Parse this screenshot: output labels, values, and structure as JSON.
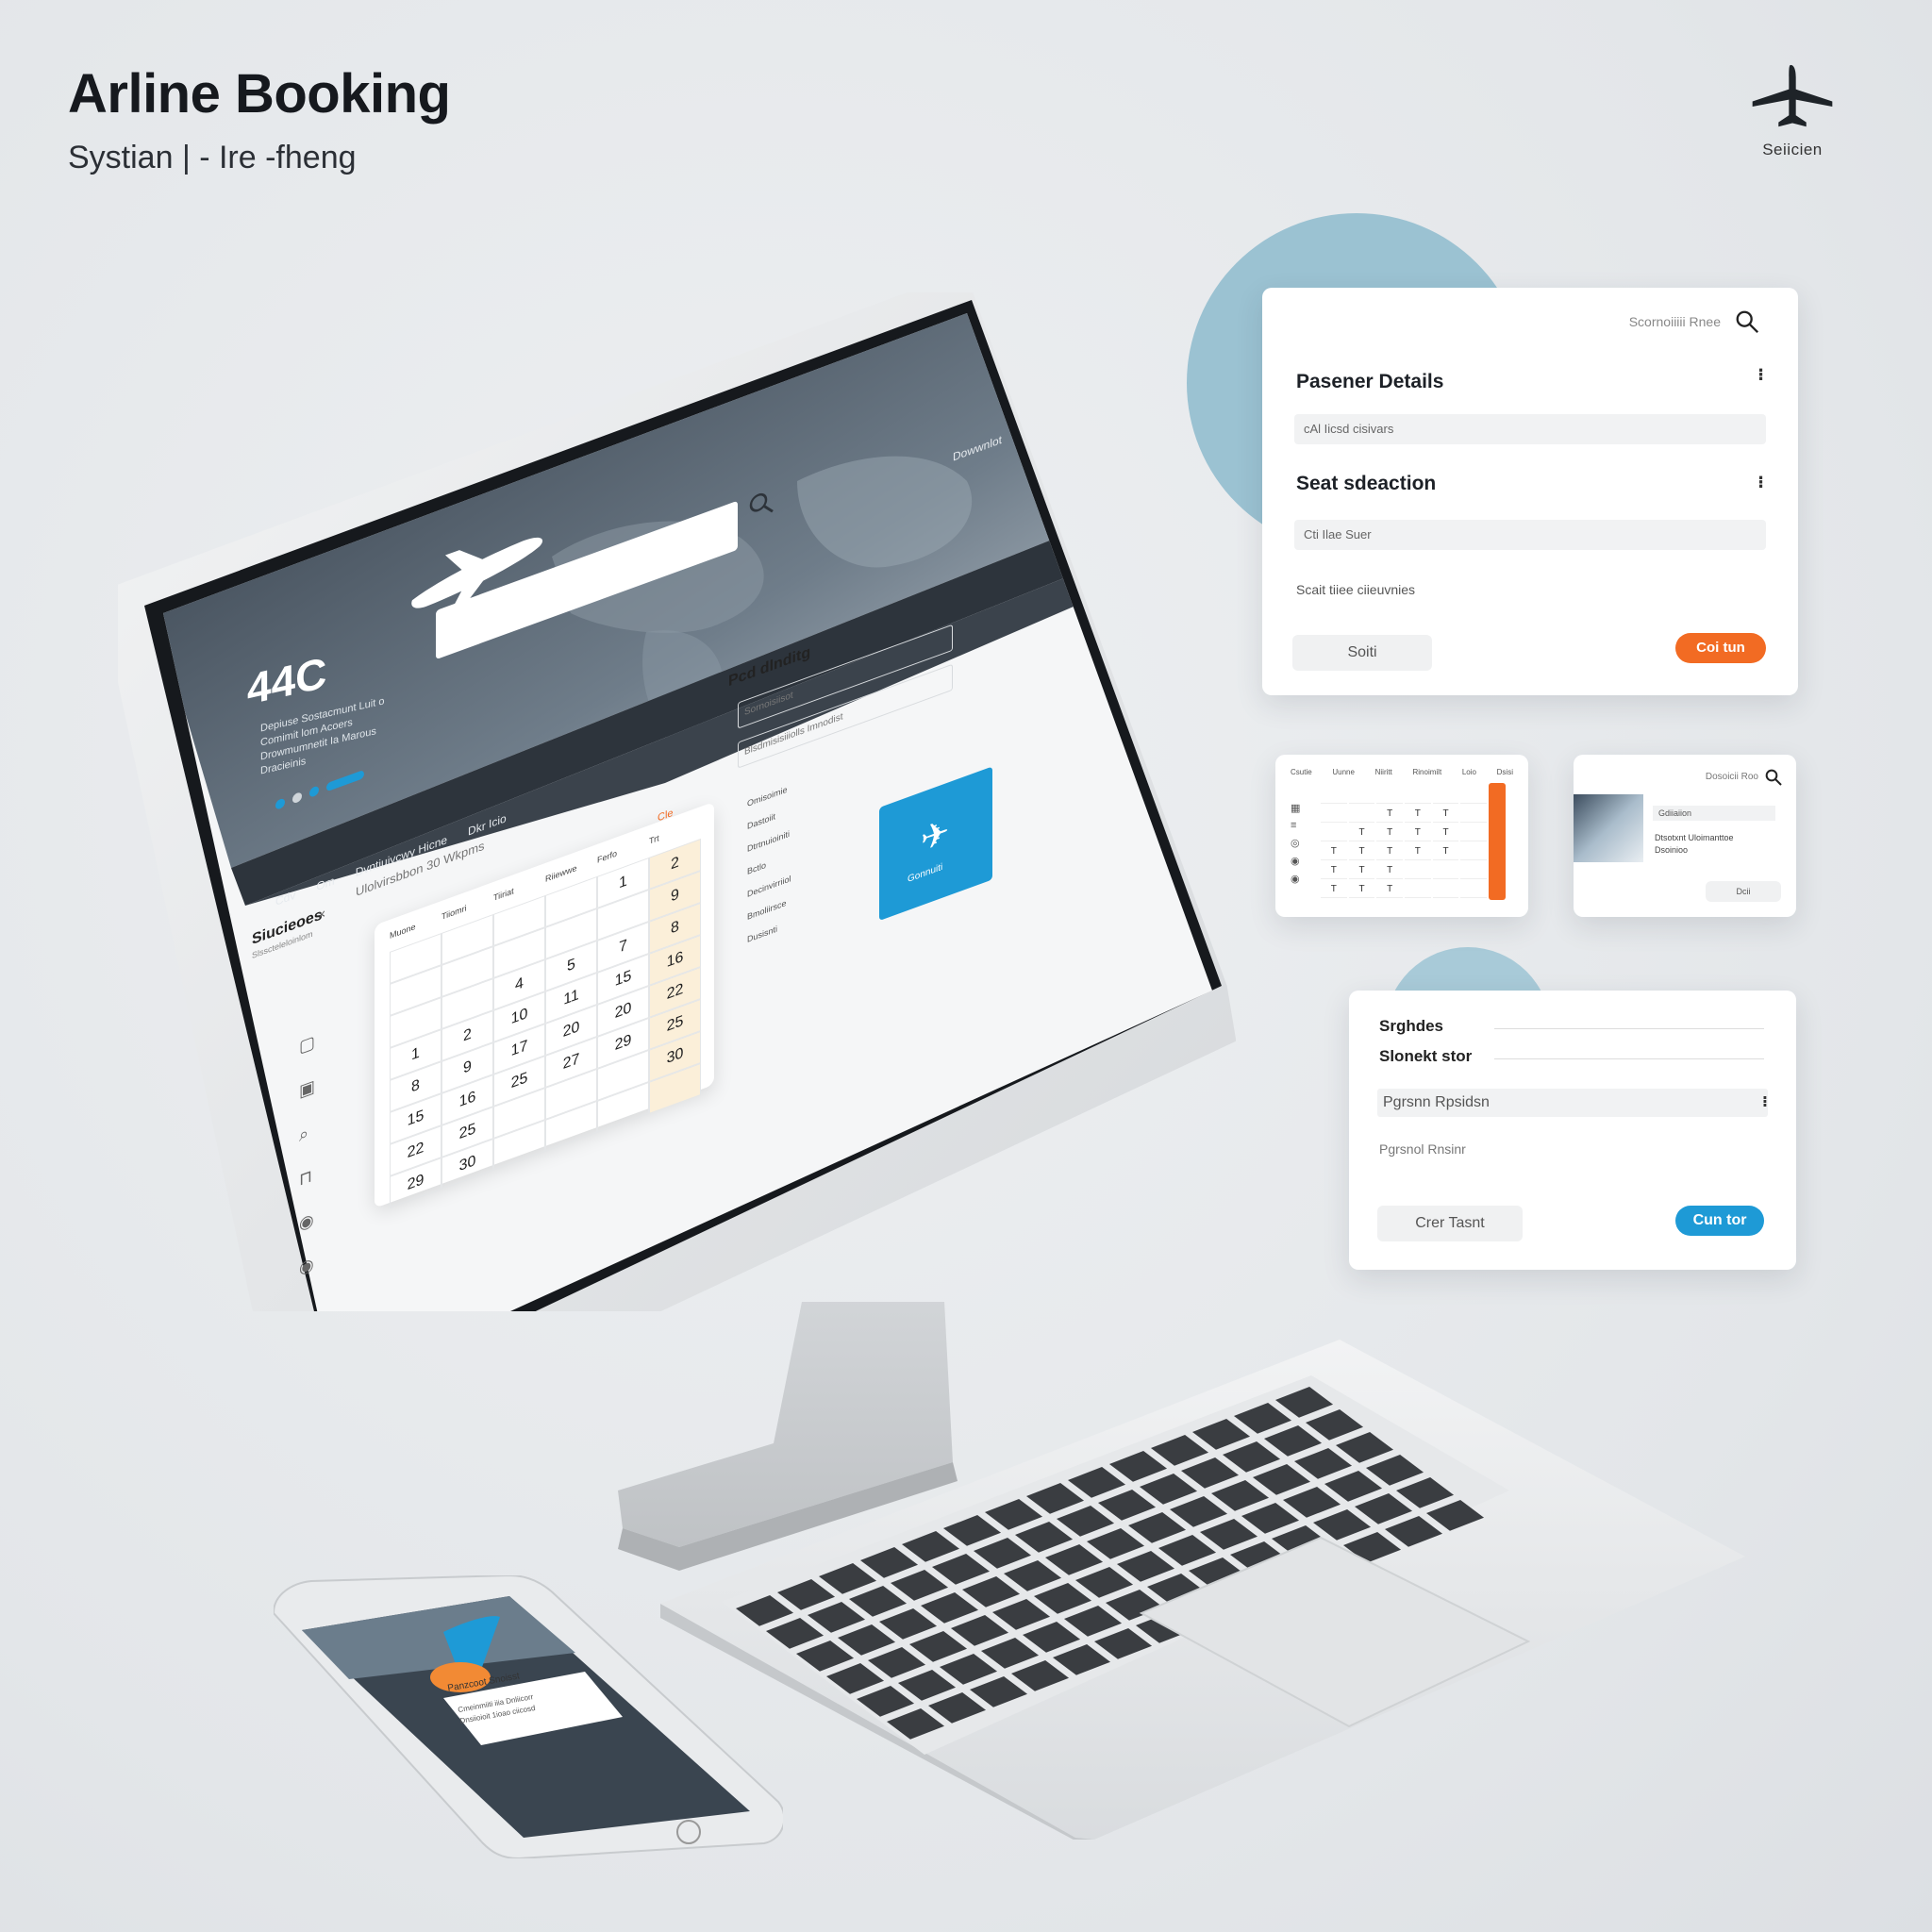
{
  "header": {
    "title": "Arline Booking",
    "subtitle": "Systian | - Ire -fheng",
    "brand_label": "Seiicien"
  },
  "monitor": {
    "hero": {
      "big_text": "44C",
      "desc": [
        "Depiuse Sostacmunt Luit o",
        "Comimit lom Acoers",
        "Drowmumnetit Ia Marous",
        "Dracieinis"
      ]
    },
    "top_right_label": "Dowwnlot",
    "nav_items": [
      "Cdv",
      "Om",
      "Dvntiuivcwy Hicne",
      "Dkr Icio"
    ],
    "calendar": {
      "title": "Siucieoes",
      "subtitle": "Slsscteleloinlom",
      "close": "×",
      "header_note": "Ulolvirsbbon 30 Wkpms",
      "corner_label": "Cle",
      "weekdays": [
        "Muone",
        "Tiiomri",
        "Tiiriat",
        "Riiewwe",
        "Ferfo",
        "Trt"
      ],
      "days": [
        "",
        "",
        "",
        "",
        "1",
        "2",
        "",
        "",
        "",
        "",
        "",
        "9",
        "",
        "",
        "4",
        "5",
        "7",
        "8",
        "1",
        "2",
        "10",
        "11",
        "15",
        "16",
        "8",
        "9",
        "17",
        "20",
        "20",
        "22",
        "15",
        "16",
        "25",
        "27",
        "29",
        "25",
        "22",
        "25",
        "",
        "",
        "",
        "30",
        "29",
        "30",
        "",
        "",
        "",
        ""
      ]
    },
    "right_panel": {
      "title": "Pcd dlnditg",
      "inputs": [
        "Sornoisiisot",
        "Blsdmisisiiiolls Imnodist"
      ],
      "list": [
        "Omisoimie",
        "Dastoiit",
        "Dtrtnuioiniti",
        "Bctlo",
        "Decinvirriiol",
        "Bmoliirsce",
        "Dusisnti"
      ],
      "feature_label": "Gonnuiti"
    }
  },
  "card1": {
    "search_label": "Scornoiiiii Rnee",
    "passenger_heading": "Pasener Details",
    "passenger_field": "cAl Iicsd cisivars",
    "seat_heading": "Seat sdeaction",
    "seat_field": "Cti Ilae Suer",
    "note": "Scait tiiee ciieuvnies",
    "left_button": "Soiti",
    "right_button": "Coi tun"
  },
  "card2": {
    "headers": [
      "Csutie",
      "Uunne",
      "Niiritt",
      "Rinoimilt",
      "Loio",
      "Dsisi"
    ],
    "cells": [
      "",
      "",
      "",
      "",
      "",
      "",
      "",
      "",
      "T",
      "T",
      "T",
      "",
      "",
      "T",
      "T",
      "T",
      "T",
      "",
      "T",
      "T",
      "T",
      "T",
      "T",
      "",
      "T",
      "T",
      "T",
      "",
      "",
      "",
      "T",
      "T",
      "T",
      "",
      "",
      ""
    ]
  },
  "card3": {
    "search_label": "Dosoicii Roo",
    "field": "Gdiiaiion",
    "desc": [
      "Dtsotxnt Uloimanttoe",
      "Dsoinioo"
    ],
    "button": "Dcii"
  },
  "card4": {
    "label1": "Srghdes",
    "label2": "Slonekt stor",
    "field": "Pgrsnn Rpsidsn",
    "note": "Pgrsnol Rnsinr",
    "left_button": "Crer Tasnt",
    "right_button": "Cun tor"
  },
  "phone": {
    "card_title": "Panzcoot Snoisst",
    "card_lines": [
      "Cmeinmiiti iiia Dnliicorr",
      "Dnsiioioit 1ioao ciicosd"
    ]
  },
  "colors": {
    "accent_orange": "#f26b23",
    "accent_blue": "#1e9ad6",
    "circle_blue": "#9bc2d2",
    "screen_dark": "#3e4650"
  }
}
